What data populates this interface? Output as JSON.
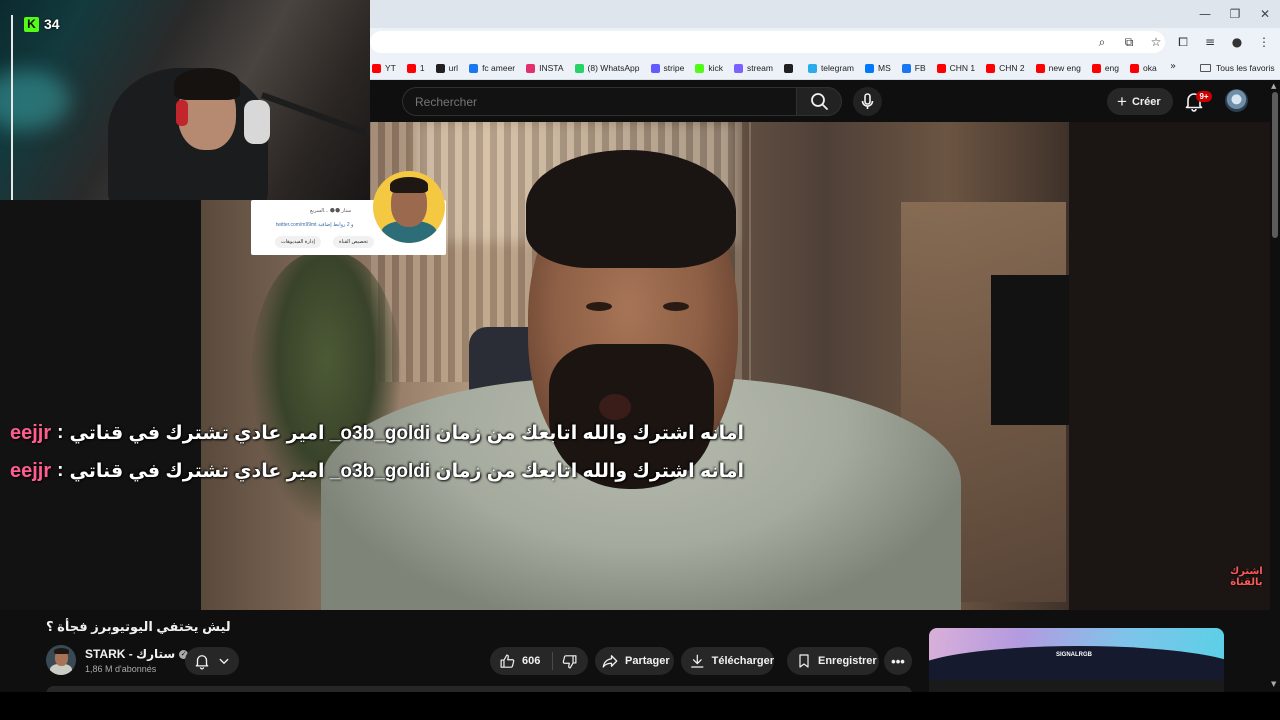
{
  "browser": {
    "bookmarks": [
      {
        "label": "YT",
        "color": "#ff0000"
      },
      {
        "label": "1",
        "color": "#ff0000"
      },
      {
        "label": "url",
        "color": "#202020"
      },
      {
        "label": "fc ameer",
        "color": "#1877f2"
      },
      {
        "label": "INSTA",
        "color": "#e1306c"
      },
      {
        "label": "(8) WhatsApp",
        "color": "#25d366"
      },
      {
        "label": "stripe",
        "color": "#635bff"
      },
      {
        "label": "kick",
        "color": "#53fc18"
      },
      {
        "label": "stream",
        "color": "#7b61ff"
      },
      {
        "label": "",
        "color": "#202020"
      },
      {
        "label": "telegram",
        "color": "#2aabee"
      },
      {
        "label": "MS",
        "color": "#0078ff"
      },
      {
        "label": "FB",
        "color": "#1877f2"
      },
      {
        "label": "CHN 1",
        "color": "#ff0000"
      },
      {
        "label": "CHN 2",
        "color": "#ff0000"
      },
      {
        "label": "new eng",
        "color": "#ff0000"
      },
      {
        "label": "eng",
        "color": "#ff0000"
      },
      {
        "label": "oka",
        "color": "#ff0000"
      }
    ],
    "more_bookmarks": "»",
    "all_bookmarks_label": "Tous les favoris"
  },
  "youtube": {
    "search_placeholder": "Rechercher",
    "create_label": "Créer",
    "notification_count": "9+"
  },
  "overlay": {
    "kick_viewers": "34",
    "chat": [
      {
        "user": "eejjr",
        "sep": ":",
        "message": "امانه اشترك والله اتابعك من زمان o3b_goldi_ امير عادي تشترك في قناتي"
      },
      {
        "user": "eejjr",
        "sep": ":",
        "message": "امانه اشترك والله اتابعك من زمان o3b_goldi_ امير عادي تشترك في قناتي"
      }
    ],
    "card": {
      "line1": "ستار 🌑🌑 ...السريع",
      "line2": "twitter.com/m99mt و 2 روابط إضافية",
      "btn_customize": "تخصيص القناة",
      "btn_manage": "إدارة الفيديوهات"
    },
    "watermark": "اشترك\nبالقناة"
  },
  "video": {
    "title": "ليش يختفي اليوتيوبرز فجأة ؟",
    "channel_name": "STARK - ستارك",
    "subscribers": "1,86 M d'abonnés",
    "likes": "606",
    "share_label": "Partager",
    "download_label": "Télécharger",
    "save_label": "Enregistrer",
    "more_label": "•••"
  },
  "ad": {
    "brand": "SIGNALRGB"
  },
  "colors": {
    "accent_red": "#ff0000",
    "kick_green": "#53fc18",
    "chat_user": "#ff5d8f"
  }
}
